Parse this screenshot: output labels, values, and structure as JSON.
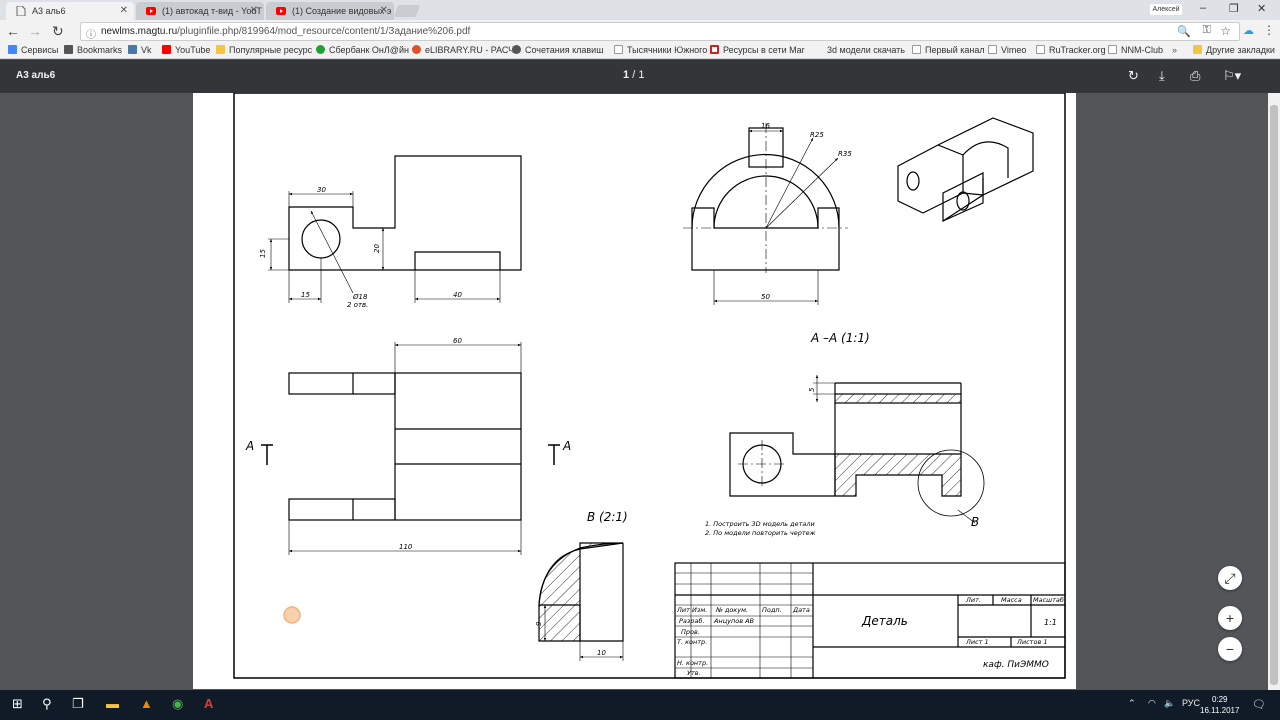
{
  "tabs": [
    {
      "label": "А3 аль6",
      "active": true
    },
    {
      "label": "(1) автокад т-вид - YouT",
      "active": false
    },
    {
      "label": "(1) Создание видовых э",
      "active": false
    }
  ],
  "profile_name": "Алексей",
  "window_controls": {
    "minimize": "–",
    "restore": "❐",
    "close": "✕"
  },
  "address": {
    "host": "newlms.magtu.ru",
    "path": "/pluginfile.php/819964/mod_resource/content/1/Задание%206.pdf"
  },
  "bookmarks": [
    {
      "label": "Сервисы",
      "color": "#4285f4"
    },
    {
      "label": "Bookmarks",
      "color": "#555555"
    },
    {
      "label": "Vk",
      "color": "#4a76a8"
    },
    {
      "label": "YouTube",
      "color": "#ff0000"
    },
    {
      "label": "Популярные ресурс",
      "color": "#f4c542"
    },
    {
      "label": "Сбербанк ОнЛ@йн",
      "color": "#21a038"
    },
    {
      "label": "eLIBRARY.RU - РАСЧ",
      "color": "#e0502a"
    },
    {
      "label": "Сочетания клавиш",
      "color": "#555555"
    },
    {
      "label": "Тысячники Южного",
      "color": "#999999"
    },
    {
      "label": "Ресурсы в сети Mar",
      "color": "#cc2222"
    },
    {
      "label": "3d модели скачать",
      "color": "#f2f2f2"
    },
    {
      "label": "Первый канал",
      "color": "#999999"
    },
    {
      "label": "Vimeo",
      "color": "#999999"
    },
    {
      "label": "RuTracker.org",
      "color": "#999999"
    },
    {
      "label": "NNM-Club",
      "color": "#999999"
    },
    {
      "label": "Другие закладки",
      "color": "#f4c542"
    }
  ],
  "pdf": {
    "title": "А3 аль6",
    "page_current": "1",
    "page_sep": "/",
    "page_total": "1"
  },
  "drawing": {
    "dims_top_left": {
      "d30": "30",
      "d15v": "15",
      "d20": "20",
      "d15h": "15",
      "d40": "40",
      "hole": "Ø18",
      "holes": "2 отв."
    },
    "dims_front": {
      "d16": "16",
      "r25": "R25",
      "r35": "R35",
      "d50": "50"
    },
    "dims_plan": {
      "d60": "60",
      "d110": "110"
    },
    "section_marker": "А",
    "section_title": "А –А  (1:1)",
    "section_dim": "5",
    "detail_title": "В  (2:1)",
    "detail_label": "В",
    "detail_dims": {
      "d9": "9",
      "d10": "10"
    },
    "notes": [
      "1.     Построить 3D модель детали",
      "2.     По модели повторить чертеж"
    ],
    "stamp": {
      "lit": "Лит",
      "izm": "Изм.",
      "doc_no": "№    докум.",
      "sign": "Подп.",
      "date": "Дата",
      "razrab": "Разраб.",
      "author": "Анцупов АВ",
      "prov": "Пров.",
      "tkontr": "Т. контр.",
      "nkontr": "Н. контр.",
      "utv": "Утв.",
      "name": "Деталь",
      "col_lit": "Лит.",
      "col_mass": "Масса",
      "col_scale": "Масштаб",
      "scale": "1:1",
      "sheet": "Лист  1",
      "sheets": "Листов  1",
      "org": "каф. ПиЭММО"
    }
  },
  "zoom": {
    "fit": "⤢",
    "plus": "+",
    "minus": "−"
  },
  "taskbar": {
    "lang": "РУС",
    "time": "0:29",
    "date": "16.11.2017"
  }
}
